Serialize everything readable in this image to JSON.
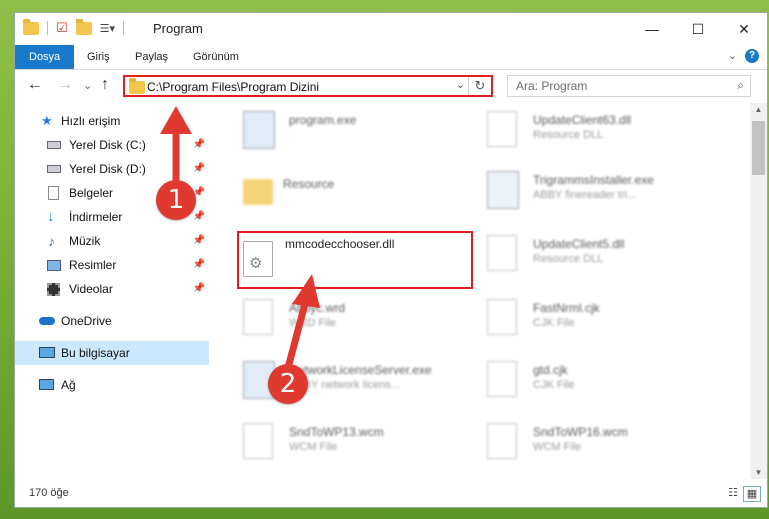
{
  "window": {
    "title": "Program",
    "controls": {
      "minimize": "—",
      "maximize": "☐",
      "close": "✕"
    }
  },
  "ribbon": {
    "tabs": [
      "Dosya",
      "Giriş",
      "Paylaş",
      "Görünüm"
    ],
    "help": "?",
    "expand": "⌄"
  },
  "navigation": {
    "back": "←",
    "forward": "→",
    "recent": "⌄",
    "up": "↑",
    "address_path": "C:\\Program Files\\Program Dizini",
    "search_placeholder": "Ara: Program"
  },
  "sidebar": {
    "items": [
      {
        "label": "Hızlı erişim",
        "icon": "star-icon",
        "pinned": false
      },
      {
        "label": "Yerel Disk (C:)",
        "icon": "drive-icon",
        "pinned": true
      },
      {
        "label": "Yerel Disk (D:)",
        "icon": "drive-icon",
        "pinned": true
      },
      {
        "label": "Belgeler",
        "icon": "documents-icon",
        "pinned": true
      },
      {
        "label": "İndirmeler",
        "icon": "download-icon",
        "pinned": true
      },
      {
        "label": "Müzik",
        "icon": "music-icon",
        "pinned": true
      },
      {
        "label": "Resimler",
        "icon": "pictures-icon",
        "pinned": true
      },
      {
        "label": "Videolar",
        "icon": "video-icon",
        "pinned": true
      },
      {
        "label": "OneDrive",
        "icon": "cloud-icon",
        "pinned": false
      },
      {
        "label": "Bu bilgisayar",
        "icon": "computer-icon",
        "pinned": false,
        "selected": true
      },
      {
        "label": "Ağ",
        "icon": "network-icon",
        "pinned": false
      }
    ]
  },
  "files": [
    {
      "name": "program.exe",
      "type": "",
      "icon": "exe-icon"
    },
    {
      "name": "UpdateClient63.dll",
      "type": "Resource DLL",
      "icon": "dll-icon"
    },
    {
      "name": "Resource",
      "type": "",
      "icon": "folder-icon"
    },
    {
      "name": "TrigrammsInstaller.exe",
      "type": "ABBY finereader tri...",
      "icon": "installer-icon"
    },
    {
      "name": "mmcodecchooser.dll",
      "type": "",
      "icon": "dll-icon",
      "highlighted": true
    },
    {
      "name": "UpdateClient5.dll",
      "type": "Resource DLL",
      "icon": "dll-icon"
    },
    {
      "name": "Abbyc.wrd",
      "type": "WRD File",
      "icon": "document-icon"
    },
    {
      "name": "FastNrml.cjk",
      "type": "CJK File",
      "icon": "document-icon"
    },
    {
      "name": "NetworkLicenseServer.exe",
      "type": "ABBY network licens...",
      "icon": "exe-icon"
    },
    {
      "name": "gtd.cjk",
      "type": "CJK File",
      "icon": "document-icon"
    },
    {
      "name": "SndToWP13.wcm",
      "type": "WCM File",
      "icon": "document-icon"
    },
    {
      "name": "SndToWP16.wcm",
      "type": "WCM File",
      "icon": "document-icon"
    }
  ],
  "status": {
    "item_count": "170 öğe"
  },
  "annotations": {
    "badge1": "1",
    "badge2": "2",
    "color": "#e03a30"
  }
}
